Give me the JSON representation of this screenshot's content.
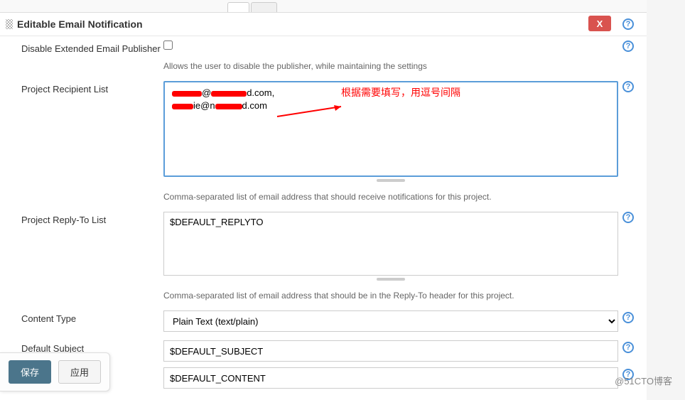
{
  "section": {
    "title": "Editable Email Notification",
    "close": "X"
  },
  "fields": {
    "disable_publisher": {
      "label": "Disable Extended Email Publisher",
      "hint": "Allows the user to disable the publisher, while maintaining the settings",
      "checked": false
    },
    "recipients": {
      "label": "Project Recipient List",
      "email_domain1": "d.com,",
      "email_domain2": "d.com",
      "email_fragment": "ie@n",
      "annotation": "根据需要填写，用逗号间隔",
      "hint": "Comma-separated list of email address that should receive notifications for this project."
    },
    "replyto": {
      "label": "Project Reply-To List",
      "value": "$DEFAULT_REPLYTO",
      "hint": "Comma-separated list of email address that should be in the Reply-To header for this project."
    },
    "content_type": {
      "label": "Content Type",
      "selected": "Plain Text (text/plain)"
    },
    "subject": {
      "label": "Default Subject",
      "value": "$DEFAULT_SUBJECT"
    },
    "content": {
      "value": "$DEFAULT_CONTENT"
    }
  },
  "buttons": {
    "save": "保存",
    "apply": "应用"
  },
  "help_glyph": "?",
  "watermark": "@51CTO博客"
}
